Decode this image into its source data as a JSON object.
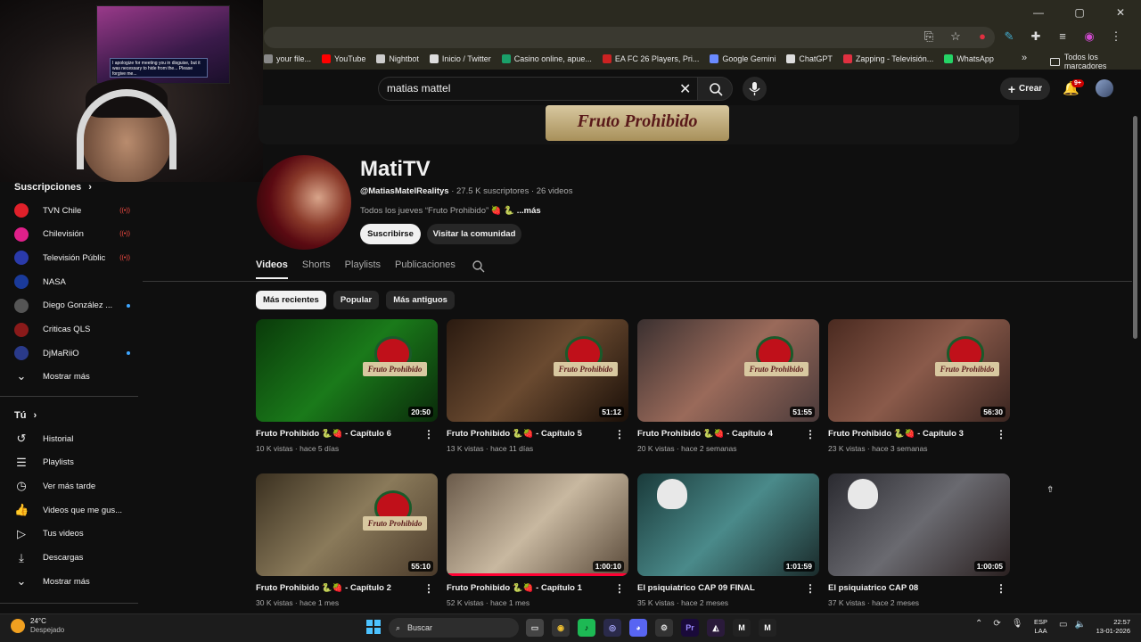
{
  "browser": {
    "window_controls": [
      "—",
      "▢",
      "✕"
    ],
    "bookmarks": [
      {
        "label": "your file...",
        "color": "#888888"
      },
      {
        "label": "YouTube",
        "color": "#ff0000"
      },
      {
        "label": "Nightbot",
        "color": "#cccccc"
      },
      {
        "label": "Inicio / Twitter",
        "color": "#dddddd"
      },
      {
        "label": "Casino online, apue...",
        "color": "#1aa06a"
      },
      {
        "label": "EA FC 26 Players, Pri...",
        "color": "#cc2222"
      },
      {
        "label": "Google Gemini",
        "color": "#6a8aff"
      },
      {
        "label": "ChatGPT",
        "color": "#dddddd"
      },
      {
        "label": "Zapping - Televisión...",
        "color": "#e03040"
      },
      {
        "label": "WhatsApp",
        "color": "#25d366"
      }
    ],
    "bookmarks_more": "»",
    "all_bookmarks": "Todos los marcadores"
  },
  "header": {
    "search_value": "matias mattel",
    "create_label": "Crear",
    "notif_count": "9+"
  },
  "webcam": {
    "dialog_text": "I apologize for meeting you in disguise, but it was necessary to hide from the... Please forgive me..."
  },
  "sidebar": {
    "subs_title": "Suscripciones",
    "subs": [
      {
        "name": "TVN Chile",
        "status": "live",
        "color": "#e0202a"
      },
      {
        "name": "Chilevisión",
        "status": "live",
        "color": "#e0208a"
      },
      {
        "name": "Televisión Pública",
        "status": "live",
        "color": "#2a3aaa"
      },
      {
        "name": "NASA",
        "status": "",
        "color": "#1a3a9a"
      },
      {
        "name": "Diego González ...",
        "status": "dot",
        "color": "#555555"
      },
      {
        "name": "Criticas QLS",
        "status": "",
        "color": "#8a1a1a"
      },
      {
        "name": "DjMaRiiO",
        "status": "dot",
        "color": "#2a3a8a"
      }
    ],
    "subs_more": "Mostrar más",
    "you_title": "Tú",
    "you_items": [
      {
        "label": "Historial",
        "icon": "history-icon",
        "glyph": "↺"
      },
      {
        "label": "Playlists",
        "icon": "playlists-icon",
        "glyph": "☰"
      },
      {
        "label": "Ver más tarde",
        "icon": "watch-later-icon",
        "glyph": "◷"
      },
      {
        "label": "Videos que me gus...",
        "icon": "like-icon",
        "glyph": "👍"
      },
      {
        "label": "Tus videos",
        "icon": "your-videos-icon",
        "glyph": "▷"
      },
      {
        "label": "Descargas",
        "icon": "download-icon",
        "glyph": "⤓"
      }
    ],
    "you_more": "Mostrar más"
  },
  "channel": {
    "banner_text": "Fruto Prohibido",
    "name": "MatiTV",
    "handle": "@MatiasMatelRealitys",
    "subs": "· 27.5 K suscriptores",
    "videos": "· 26 videos",
    "desc": "Todos los jueves “Fruto Prohibido” 🍓 🐍",
    "desc_more": "...más",
    "subscribe": "Suscribirse",
    "community": "Visitar la comunidad"
  },
  "tabs": [
    "Videos",
    "Shorts",
    "Playlists",
    "Publicaciones"
  ],
  "chips": [
    "Más recientes",
    "Popular",
    "Más antiguos"
  ],
  "videos": [
    {
      "title": "Fruto Prohibido 🐍🍓 - Capítulo 6",
      "meta": "10 K vistas · hace 5 días",
      "duration": "20:50",
      "bg": "linear-gradient(135deg,#0a3a0a,#1a7a1a 50%,#0a2a0a)",
      "logo": true,
      "progress": 0
    },
    {
      "title": "Fruto Prohibido 🐍🍓 - Capítulo 5",
      "meta": "13 K vistas · hace 11 días",
      "duration": "51:12",
      "bg": "linear-gradient(135deg,#2a1a10,#6a4a30 50%,#1a0f08)",
      "logo": true,
      "progress": 0
    },
    {
      "title": "Fruto Prohibido 🐍🍓 - Capítulo 4",
      "meta": "20 K vistas · hace 2 semanas",
      "duration": "51:55",
      "bg": "linear-gradient(135deg,#3a3030,#9a6a5a 50%,#4a3a3a)",
      "logo": true,
      "progress": 0
    },
    {
      "title": "Fruto Prohibido 🐍🍓 - Capítulo 3",
      "meta": "23 K vistas · hace 3 semanas",
      "duration": "56:30",
      "bg": "linear-gradient(135deg,#4a2a20,#8a5a4a 50%,#3a2520)",
      "logo": true,
      "progress": 0
    },
    {
      "title": "Fruto Prohibido 🐍🍓 - Capítulo 2",
      "meta": "30 K vistas · hace 1 mes",
      "duration": "55:10",
      "bg": "linear-gradient(135deg,#3a3020,#8a7a5a 50%,#4a3a2a)",
      "logo": true,
      "progress": 0
    },
    {
      "title": "Fruto Prohibido 🐍🍓 - Capítulo 1",
      "meta": "52 K vistas · hace 1 mes",
      "duration": "1:00:10",
      "bg": "linear-gradient(135deg,#6a5a4a,#c8b8a0 50%,#5a4a3a)",
      "logo": false,
      "progress": 1
    },
    {
      "title": "El psiquiatrico CAP 09 FINAL",
      "meta": "35 K vistas · hace 2 meses",
      "duration": "1:01:59",
      "bg": "linear-gradient(135deg,#1a3a3a,#4a8a8a 50%,#1a2a2a)",
      "logo": false,
      "skull": true,
      "progress": 0
    },
    {
      "title": "El psiquiatrico CAP 08",
      "meta": "37 K vistas · hace 2 meses",
      "duration": "1:00:05",
      "bg": "linear-gradient(135deg,#2a2a30,#6a6a70 50%,#2a2020)",
      "logo": false,
      "skull": true,
      "progress": 0
    }
  ],
  "taskbar": {
    "temp": "24°C",
    "weather": "Despejado",
    "search": "Buscar",
    "apps": [
      {
        "name": "files-app",
        "label": "▭",
        "bg": "#444444",
        "color": "#dddddd"
      },
      {
        "name": "chrome-app",
        "label": "◉",
        "bg": "#333333",
        "color": "#f0c030"
      },
      {
        "name": "spotify-app",
        "label": "♪",
        "bg": "#1db954",
        "color": "#000000"
      },
      {
        "name": "app-4",
        "label": "◎",
        "bg": "#2a2a4a",
        "color": "#aaaaff"
      },
      {
        "name": "discord-app",
        "label": "◕",
        "bg": "#5865f2",
        "color": "#ffffff"
      },
      {
        "name": "app-6",
        "label": "⚙",
        "bg": "#333333",
        "color": "#dddddd"
      },
      {
        "name": "premiere-app",
        "label": "Pr",
        "bg": "#1a0a3a",
        "color": "#9a8aff"
      },
      {
        "name": "app-8",
        "label": "◭",
        "bg": "#2a1a3a",
        "color": "#ffffff"
      },
      {
        "name": "app-9",
        "label": "M",
        "bg": "#222222",
        "color": "#ffffff"
      },
      {
        "name": "app-10",
        "label": "M",
        "bg": "#222222",
        "color": "#ffffff"
      }
    ],
    "lang1": "ESP",
    "lang2": "LAA",
    "time": "22:57",
    "date": "13-01-2026"
  }
}
